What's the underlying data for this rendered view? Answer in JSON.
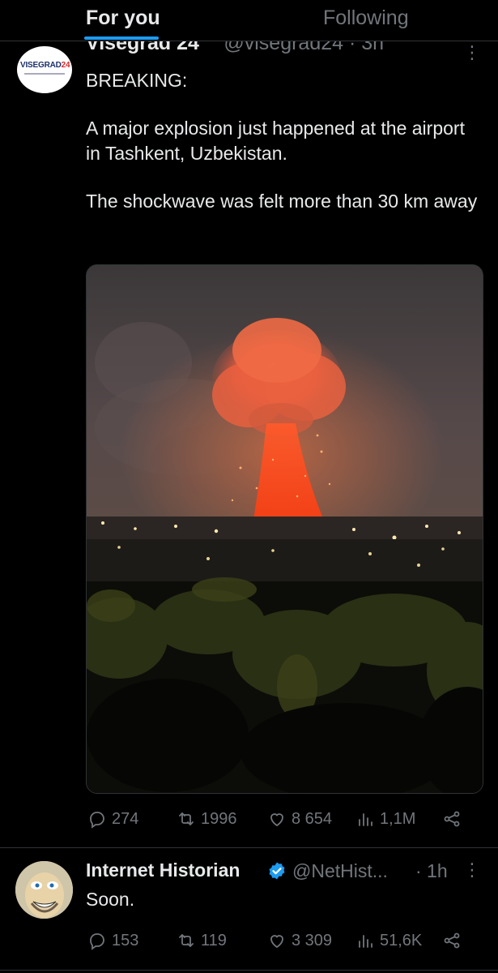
{
  "tabs": {
    "for_you": "For you",
    "following": "Following"
  },
  "tweet1": {
    "author_name": "Visegrad 24",
    "author_handle": "@visegrad24 · 3h",
    "avatar_brand": "VISEGRAD",
    "avatar_brand_num": "24",
    "lines": [
      "BREAKING:",
      "A major explosion just happened at the airport in Tashkent, Uzbekistan.",
      "The shockwave was felt more than 30 km away"
    ],
    "media_icon": "photo-explosion-night-city",
    "stats": {
      "replies": "274",
      "reposts": "1996",
      "likes": "8 654",
      "views": "1,1M"
    }
  },
  "tweet2": {
    "author_name": "Internet Historian",
    "author_handle": "@NetHist...",
    "time": "· 1h",
    "text": "Soon.",
    "stats": {
      "replies": "153",
      "reposts": "119",
      "likes": "3 309",
      "views": "51,6K"
    }
  },
  "icons": [
    "reply-icon",
    "repost-icon",
    "like-icon",
    "views-icon",
    "share-icon",
    "more-icon",
    "verified-icon"
  ],
  "colors": {
    "accent": "#1d9bf0",
    "muted": "#71767b",
    "text": "#e7e9ea",
    "bg": "#000000"
  }
}
